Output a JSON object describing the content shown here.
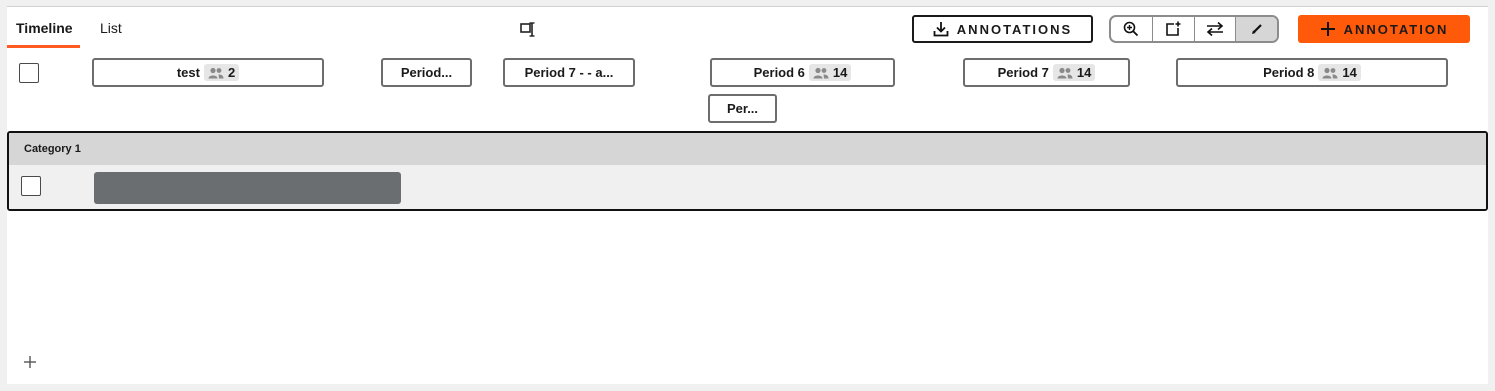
{
  "tabs": {
    "timeline": "Timeline",
    "list": "List"
  },
  "toolbar": {
    "export_label": "ANNOTATIONS",
    "add_label": "ANNOTATION",
    "accent_color": "#ff5a0a",
    "tools": [
      "zoom-in-icon",
      "add-frame-icon",
      "swap-icon",
      "pen-icon"
    ]
  },
  "periods": [
    {
      "name": "test",
      "count": "2"
    },
    {
      "name": "Period..."
    },
    {
      "name": "Period 7 - - a..."
    },
    {
      "name": "Period 6",
      "count": "14"
    },
    {
      "name": "Period 7",
      "count": "14"
    },
    {
      "name": "Period 8",
      "count": "14"
    },
    {
      "name": "Per..."
    }
  ],
  "category": {
    "title": "Category 1"
  }
}
